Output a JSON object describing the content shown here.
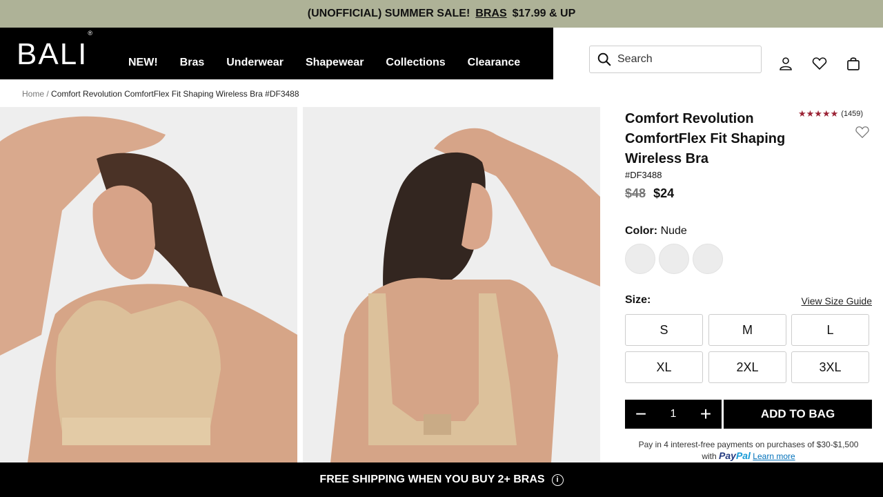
{
  "promo": {
    "prefix": "(UNOFFICIAL) SUMMER SALE!",
    "link": "BRAS",
    "suffix": "$17.99 & UP"
  },
  "header": {
    "logo": "BALI",
    "logo_mark": "®",
    "menu": [
      "NEW!",
      "Bras",
      "Underwear",
      "Shapewear",
      "Collections",
      "Clearance"
    ],
    "search_placeholder": "Search"
  },
  "breadcrumb": {
    "home": "Home",
    "separator": "/",
    "current": "Comfort Revolution ComfortFlex Fit Shaping Wireless Bra #DF3488"
  },
  "product": {
    "title": "Comfort Revolution ComfortFlex Fit Shaping Wireless Bra",
    "sku": "#DF3488",
    "price_old": "$48",
    "price_new": "$24",
    "rating_stars": "★★★★★",
    "rating_value": 4.5,
    "review_count": "(1459)",
    "color_label": "Color:",
    "color_value": "Nude",
    "size_label": "Size:",
    "size_guide": "View Size Guide",
    "sizes": [
      "S",
      "M",
      "L",
      "XL",
      "2XL",
      "3XL"
    ],
    "quantity": "1",
    "minus": "−",
    "plus": "+",
    "add_to_bag": "ADD TO BAG",
    "paypal_text": "Pay in 4 interest-free payments on purchases of $30-$1,500",
    "paypal_with": "with",
    "paypal_brand_1": "Pay",
    "paypal_brand_2": "Pal",
    "paypal_learn": "Learn more"
  },
  "footer": {
    "shipping": "FREE SHIPPING WHEN YOU BUY 2+ BRAS",
    "info_icon": "i"
  },
  "colors": {
    "promo_bg": "#aeb297",
    "header_bg": "#000000",
    "star": "#9b2335"
  }
}
